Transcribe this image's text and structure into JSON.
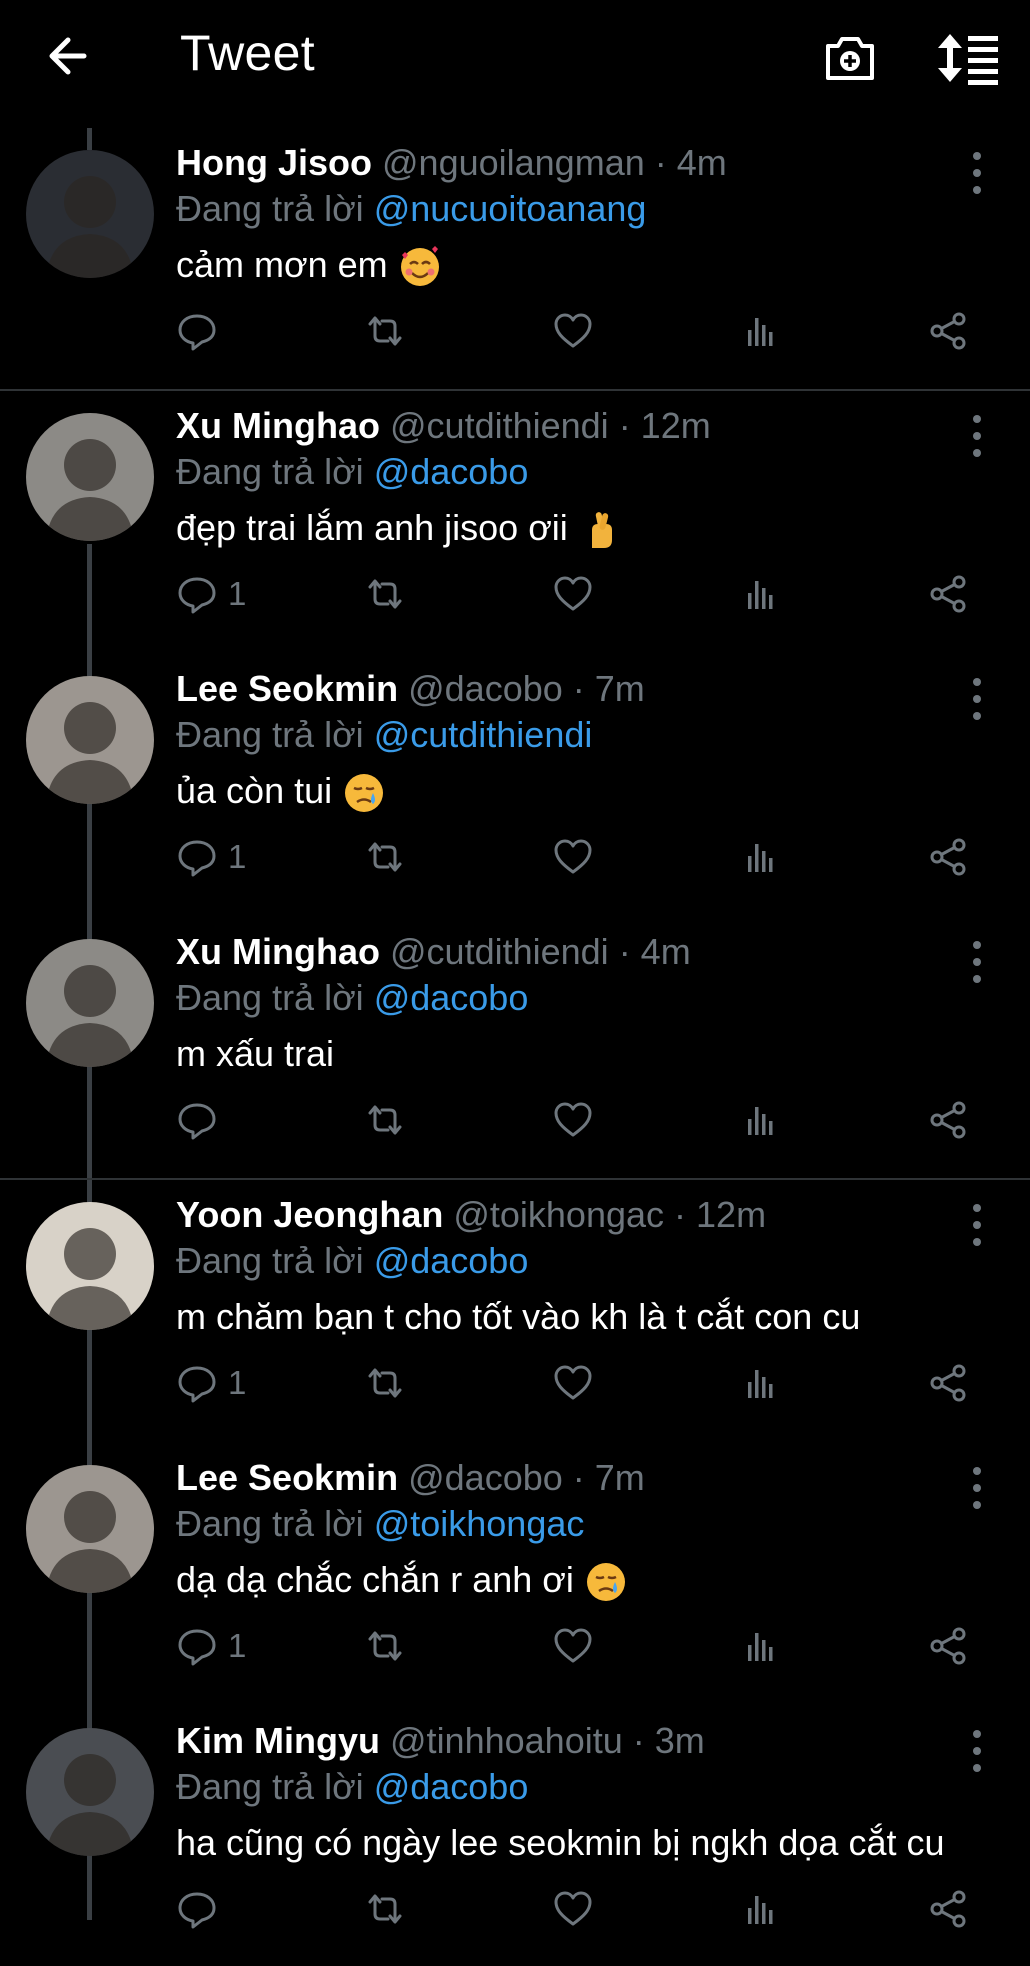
{
  "header": {
    "title": "Tweet"
  },
  "tweets": [
    {
      "name": "Hong Jisoo",
      "handle": "@nguoilangman",
      "time": "· 4m",
      "reply_prefix": "Đang trả lời ",
      "reply_to": "@nucuoitoanang",
      "text": "cảm mơn em",
      "emoji": "smiling-hearts-emoji",
      "reply_count": "",
      "avatar_color": "#2a2d33"
    },
    {
      "name": "Xu Minghao",
      "handle": "@cutdithiendi",
      "time": "· 12m",
      "reply_prefix": "Đang trả lời ",
      "reply_to": "@dacobo",
      "text": "đẹp trai lắm anh jisoo ơii",
      "emoji": "crossed-fingers-emoji",
      "reply_count": "1",
      "avatar_color": "#8c8a86"
    },
    {
      "name": "Lee Seokmin",
      "handle": "@dacobo",
      "time": "· 7m",
      "reply_prefix": "Đang trả lời ",
      "reply_to": "@cutdithiendi",
      "text": "ủa còn tui",
      "emoji": "crying-face-emoji",
      "reply_count": "1",
      "avatar_color": "#9c9690"
    },
    {
      "name": "Xu Minghao",
      "handle": "@cutdithiendi",
      "time": "· 4m",
      "reply_prefix": "Đang trả lời ",
      "reply_to": "@dacobo",
      "text": "m xấu trai",
      "emoji": "",
      "reply_count": "",
      "avatar_color": "#8c8a86"
    },
    {
      "name": "Yoon Jeonghan",
      "handle": "@toikhongac",
      "time": "· 12m",
      "reply_prefix": "Đang trả lời ",
      "reply_to": "@dacobo",
      "text": "m chăm bạn t cho tốt vào kh là t cắt con cu",
      "emoji": "",
      "reply_count": "1",
      "avatar_color": "#d8d2c8"
    },
    {
      "name": "Lee Seokmin",
      "handle": "@dacobo",
      "time": "· 7m",
      "reply_prefix": "Đang trả lời ",
      "reply_to": "@toikhongac",
      "text": "dạ dạ chắc chắn r anh ơi",
      "emoji": "crying-face-emoji",
      "reply_count": "1",
      "avatar_color": "#9c9690"
    },
    {
      "name": "Kim Mingyu",
      "handle": "@tinhhoahoitu",
      "time": "· 3m",
      "reply_prefix": "Đang trả lời ",
      "reply_to": "@dacobo",
      "text": "ha cũng có ngày lee seokmin bị ngkh dọa cắt cu",
      "emoji": "",
      "reply_count": "",
      "avatar_color": "#4a4d52"
    }
  ],
  "colors": {
    "background": "#000000",
    "text": "#ffffff",
    "muted": "#6e767d",
    "link": "#3a9be8",
    "divider": "#2f3336"
  },
  "icons": [
    "back-arrow-icon",
    "camera-plus-icon",
    "sort-icon",
    "more-icon",
    "reply-icon",
    "retweet-icon",
    "like-icon",
    "analytics-icon",
    "share-icon"
  ]
}
